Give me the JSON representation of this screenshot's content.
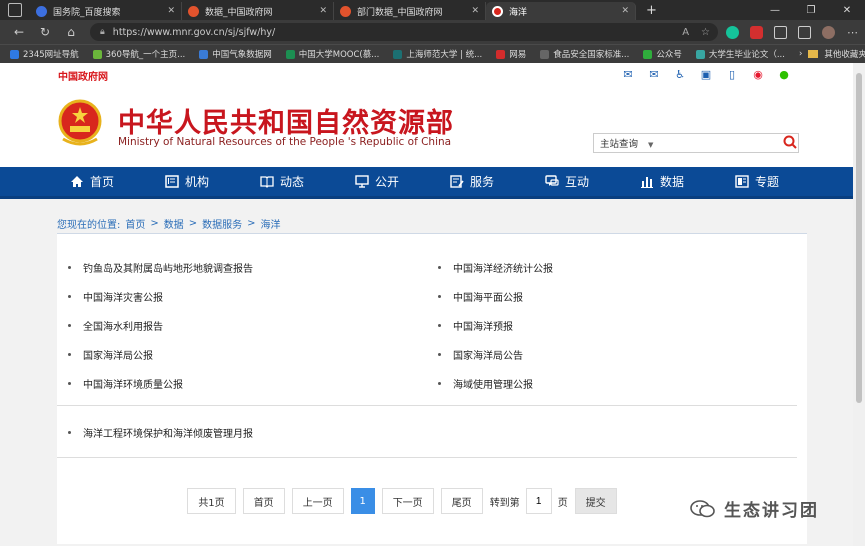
{
  "browser": {
    "tabs": [
      {
        "title": "国务院_百度搜索",
        "color": "#3c6fe0",
        "active": false
      },
      {
        "title": "数据_中国政府网",
        "color": "#e2532d",
        "active": false
      },
      {
        "title": "部门数据_中国政府网",
        "color": "#e2532d",
        "active": false
      },
      {
        "title": "海洋",
        "color": "#d8261d",
        "active": true
      }
    ],
    "new_tab": "+",
    "url": "https://www.mnr.gov.cn/sj/sjfw/hy/",
    "bookmarks": [
      {
        "label": "2345网址导航",
        "color": "#2f7ae5"
      },
      {
        "label": "360导航_一个主页...",
        "color": "#6bb63b"
      },
      {
        "label": "中国气象数据网",
        "color": "#3a7bd5"
      },
      {
        "label": "中国大学MOOC(慕...",
        "color": "#1c8f52"
      },
      {
        "label": "上海师范大学 | 统...",
        "color": "#1c6f72"
      },
      {
        "label": "网易",
        "color": "#d22c2c"
      },
      {
        "label": "食品安全国家标准...",
        "color": "#666666"
      },
      {
        "label": "公众号",
        "color": "#2fae3c"
      },
      {
        "label": "大学生毕业论文（...",
        "color": "#38a6a2"
      }
    ],
    "other_bookmarks": "其他收藏夹"
  },
  "topstrip": {
    "gov_link": "中国政府网",
    "icons": [
      "mail-icon",
      "envelope-icon",
      "accessibility-icon",
      "app-icon",
      "mobile-icon",
      "weibo-icon",
      "wechat-icon"
    ]
  },
  "header": {
    "title": "中华人民共和国自然资源部",
    "subtitle": "Ministry of Natural Resources of the People 's Republic of China",
    "search_scope": "主站查询"
  },
  "nav": [
    {
      "label": "首页",
      "icon": "home-icon"
    },
    {
      "label": "机构",
      "icon": "org-icon"
    },
    {
      "label": "动态",
      "icon": "book-icon"
    },
    {
      "label": "公开",
      "icon": "monitor-icon"
    },
    {
      "label": "服务",
      "icon": "form-icon"
    },
    {
      "label": "互动",
      "icon": "chat-icon"
    },
    {
      "label": "数据",
      "icon": "chart-icon"
    },
    {
      "label": "专题",
      "icon": "topic-icon"
    }
  ],
  "breadcrumb": {
    "prefix": "您现在的位置:",
    "items": [
      "首页",
      "数据",
      "数据服务",
      "海洋"
    ],
    "sep": ">"
  },
  "list_items": [
    "钓鱼岛及其附属岛屿地形地貌调查报告",
    "中国海洋经济统计公报",
    "中国海洋灾害公报",
    "中国海平面公报",
    "全国海水利用报告",
    "中国海洋预报",
    "国家海洋局公报",
    "国家海洋局公告",
    "中国海洋环境质量公报",
    "海域使用管理公报"
  ],
  "list_items_2": [
    "海洋工程环境保护和海洋倾废管理月报"
  ],
  "pager": {
    "total": "共1页",
    "first": "首页",
    "prev": "上一页",
    "current": "1",
    "next": "下一页",
    "last": "尾页",
    "goto_prefix": "转到第",
    "goto_value": "1",
    "goto_suffix": "页",
    "submit": "提交"
  },
  "watermark": "生态讲习团"
}
